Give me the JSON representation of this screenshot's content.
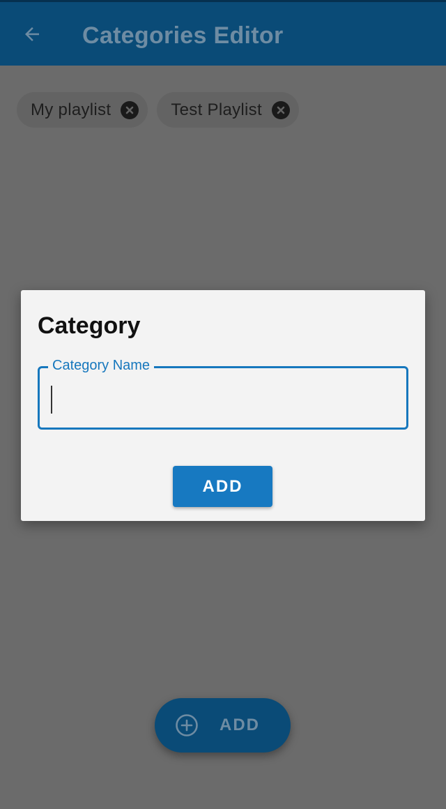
{
  "appbar": {
    "title": "Categories Editor",
    "back_icon": "arrow-left-icon"
  },
  "chips": [
    {
      "label": "My playlist",
      "close_icon": "close-circle-icon"
    },
    {
      "label": "Test Playlist",
      "close_icon": "close-circle-icon"
    }
  ],
  "dialog": {
    "title": "Category",
    "field_label": "Category Name",
    "field_value": "",
    "add_label": "ADD"
  },
  "fab": {
    "label": "ADD",
    "icon": "plus-circle-icon"
  },
  "colors": {
    "appbar": "#0a4b77",
    "accent": "#1677bd",
    "button": "#1779c1",
    "scrim_background": "#6b6b6b",
    "dialog_background": "#f3f3f3"
  }
}
